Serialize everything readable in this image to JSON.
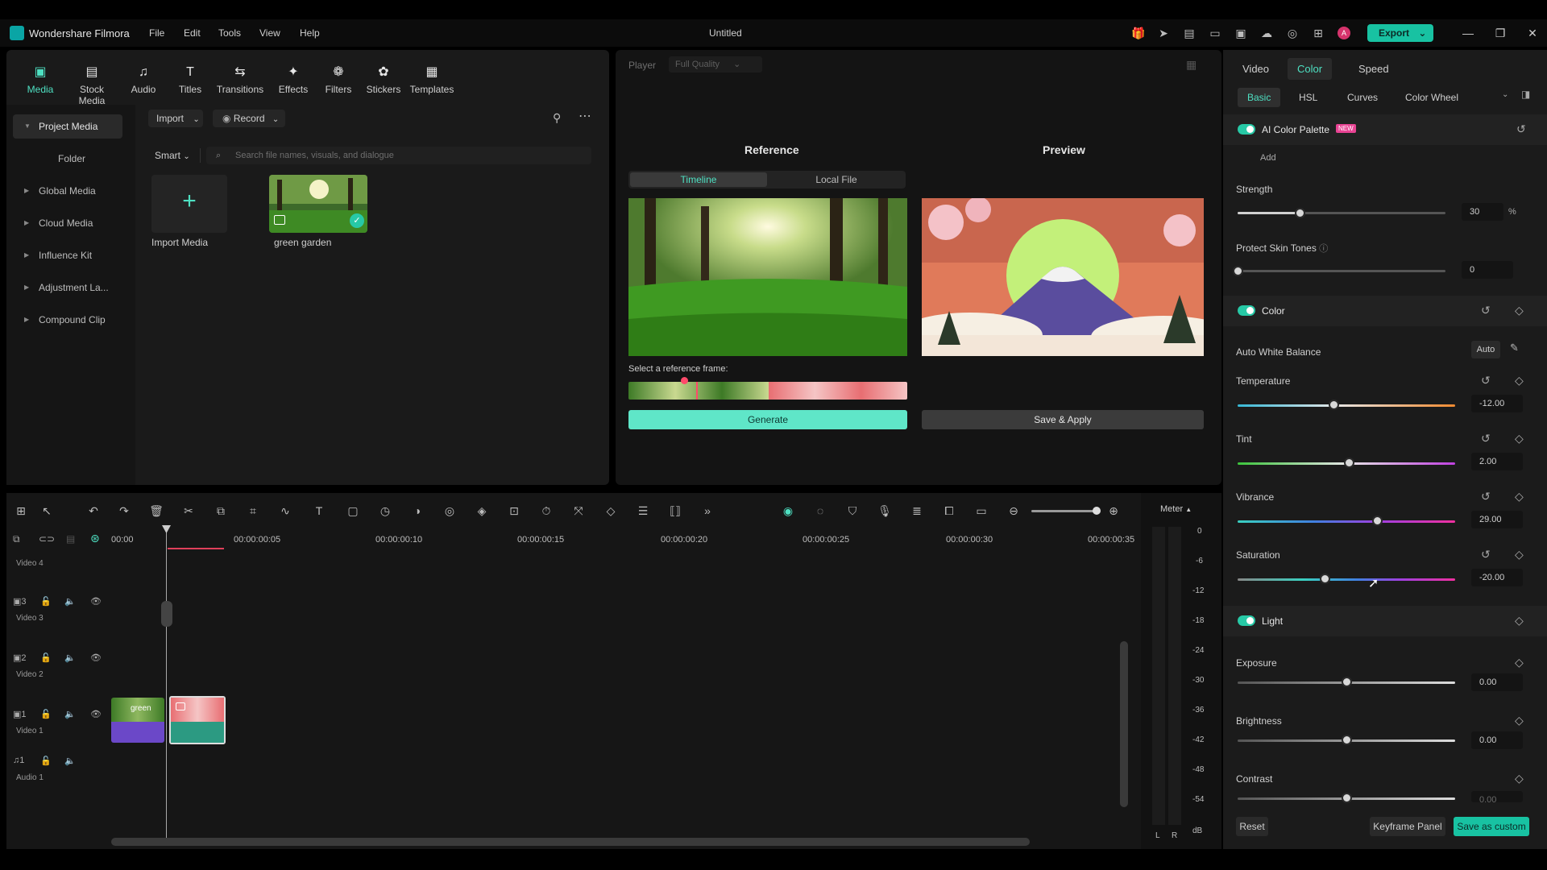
{
  "app": {
    "name": "Wondershare Filmora",
    "doc_title": "Untitled",
    "menu": [
      "File",
      "Edit",
      "Tools",
      "View",
      "Help"
    ],
    "export_label": "Export"
  },
  "toolbar": {
    "items": [
      "Media",
      "Stock Media",
      "Audio",
      "Titles",
      "Transitions",
      "Effects",
      "Filters",
      "Stickers",
      "Templates"
    ]
  },
  "media_tree": {
    "items": [
      "Project Media",
      "Folder",
      "Global Media",
      "Cloud Media",
      "Influence Kit",
      "Adjustment La...",
      "Compound Clip"
    ]
  },
  "media_panel": {
    "import_label": "Import",
    "record_label": "Record",
    "smart_label": "Smart",
    "search_placeholder": "Search file names, visuals, and dialogue",
    "import_media_label": "Import Media",
    "clip_label": "green garden"
  },
  "player": {
    "player_label": "Player",
    "quality": "Full Quality",
    "reference_label": "Reference",
    "preview_label": "Preview",
    "timeline_tab": "Timeline",
    "localfile_tab": "Local File",
    "select_frame_label": "Select a reference frame:",
    "generate_label": "Generate",
    "save_apply_label": "Save & Apply"
  },
  "right": {
    "tabs": [
      "Video",
      "Color",
      "Speed"
    ],
    "subtabs": [
      "Basic",
      "HSL",
      "Curves",
      "Color Wheel"
    ],
    "ai_palette": {
      "title": "AI Color Palette",
      "badge": "NEW",
      "add_label": "Add"
    },
    "strength": {
      "label": "Strength",
      "value": "30",
      "unit": "%",
      "level": 0.3
    },
    "skin": {
      "label": "Protect Skin Tones",
      "value": "0",
      "level": 0
    },
    "color_section": "Color",
    "awb": {
      "label": "Auto White Balance",
      "auto_label": "Auto"
    },
    "temperature": {
      "label": "Temperature",
      "value": "-12.00",
      "level": 0.44
    },
    "tint": {
      "label": "Tint",
      "value": "2.00",
      "level": 0.51
    },
    "vibrance": {
      "label": "Vibrance",
      "value": "29.00",
      "level": 0.64
    },
    "saturation": {
      "label": "Saturation",
      "value": "-20.00",
      "level": 0.4
    },
    "light_section": "Light",
    "exposure": {
      "label": "Exposure",
      "value": "0.00",
      "level": 0.5
    },
    "brightness": {
      "label": "Brightness",
      "value": "0.00",
      "level": 0.5
    },
    "contrast": {
      "label": "Contrast",
      "value": "0.00",
      "level": 0.5
    },
    "reset_label": "Reset",
    "keyframe_label": "Keyframe Panel",
    "save_custom_label": "Save as custom"
  },
  "timeline": {
    "meter_label": "Meter",
    "ruler": [
      "00:00",
      "00:00:00:05",
      "00:00:00:10",
      "00:00:00:15",
      "00:00:00:20",
      "00:00:00:25",
      "00:00:00:30",
      "00:00:00:35"
    ],
    "tracks": [
      {
        "num": "",
        "name": "Video 4"
      },
      {
        "num": "3",
        "name": "Video 3"
      },
      {
        "num": "2",
        "name": "Video 2"
      },
      {
        "num": "1",
        "name": "Video 1"
      },
      {
        "num": "1",
        "name": "Audio 1"
      }
    ],
    "clip1_label": "green",
    "db_scale": [
      "0",
      "-6",
      "-12",
      "-18",
      "-24",
      "-30",
      "-36",
      "-42",
      "-48",
      "-54",
      "dB"
    ],
    "lr": [
      "L",
      "R"
    ]
  }
}
